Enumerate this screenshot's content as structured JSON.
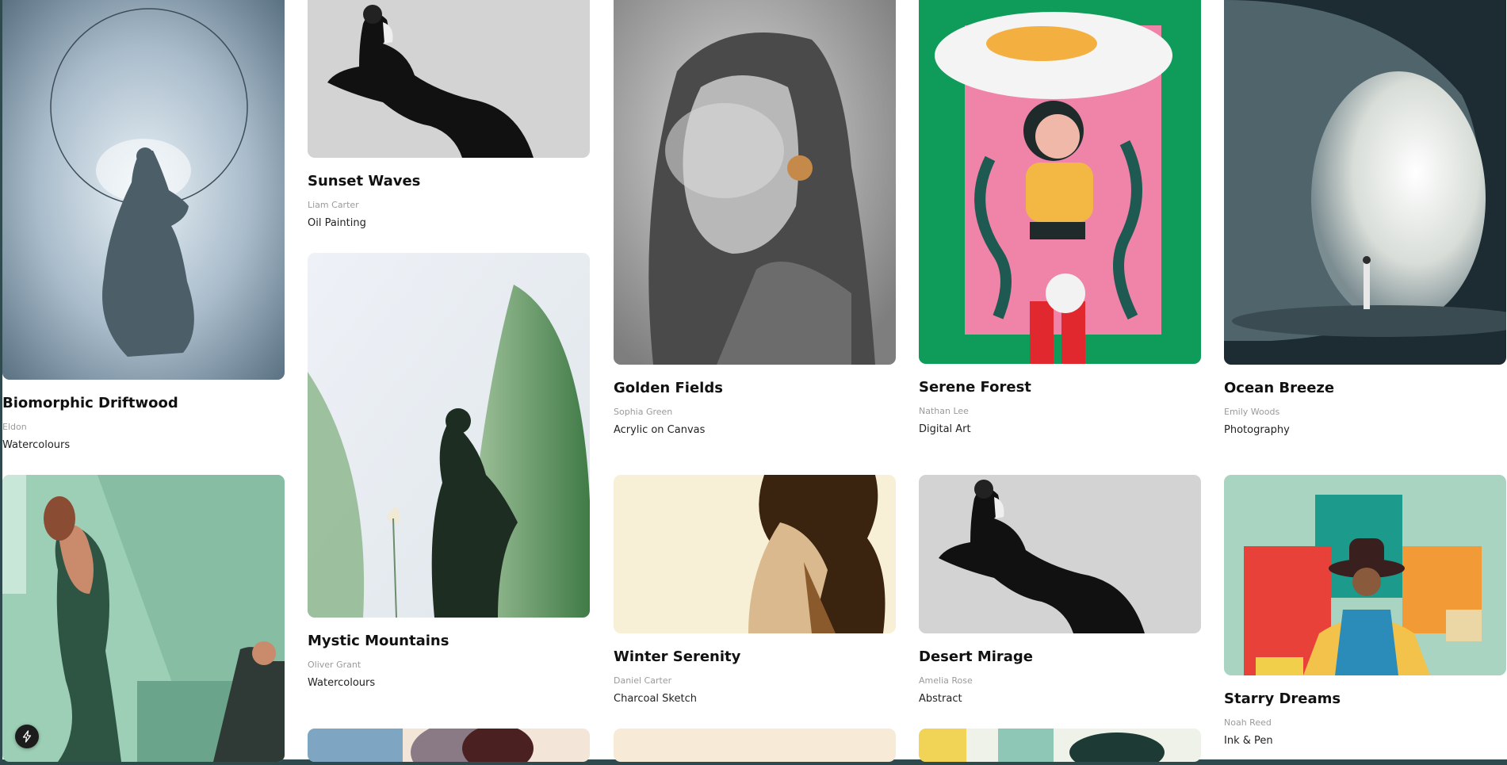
{
  "gallery": {
    "artworks": [
      {
        "title": "Biomorphic Driftwood",
        "artist": "Eldon",
        "medium": "Watercolours"
      },
      {
        "title": "Sunset Waves",
        "artist": "Liam Carter",
        "medium": "Oil Painting"
      },
      {
        "title": "Golden Fields",
        "artist": "Sophia Green",
        "medium": "Acrylic on Canvas"
      },
      {
        "title": "Serene Forest",
        "artist": "Nathan Lee",
        "medium": "Digital Art"
      },
      {
        "title": "Ocean Breeze",
        "artist": "Emily Woods",
        "medium": "Photography"
      },
      {
        "title": "Mystic Mountains",
        "artist": "Oliver Grant",
        "medium": "Watercolours"
      },
      {
        "title": "Winter Serenity",
        "artist": "Daniel Carter",
        "medium": "Charcoal Sketch"
      },
      {
        "title": "Desert Mirage",
        "artist": "Amelia Rose",
        "medium": "Abstract"
      },
      {
        "title": "Starry Dreams",
        "artist": "Noah Reed",
        "medium": "Ink & Pen"
      }
    ]
  },
  "fab": {
    "icon": "lightning-bolt-icon"
  },
  "colors": {
    "frame": "#2e4a4e",
    "title": "#111111",
    "artist": "#9a9a9a"
  }
}
